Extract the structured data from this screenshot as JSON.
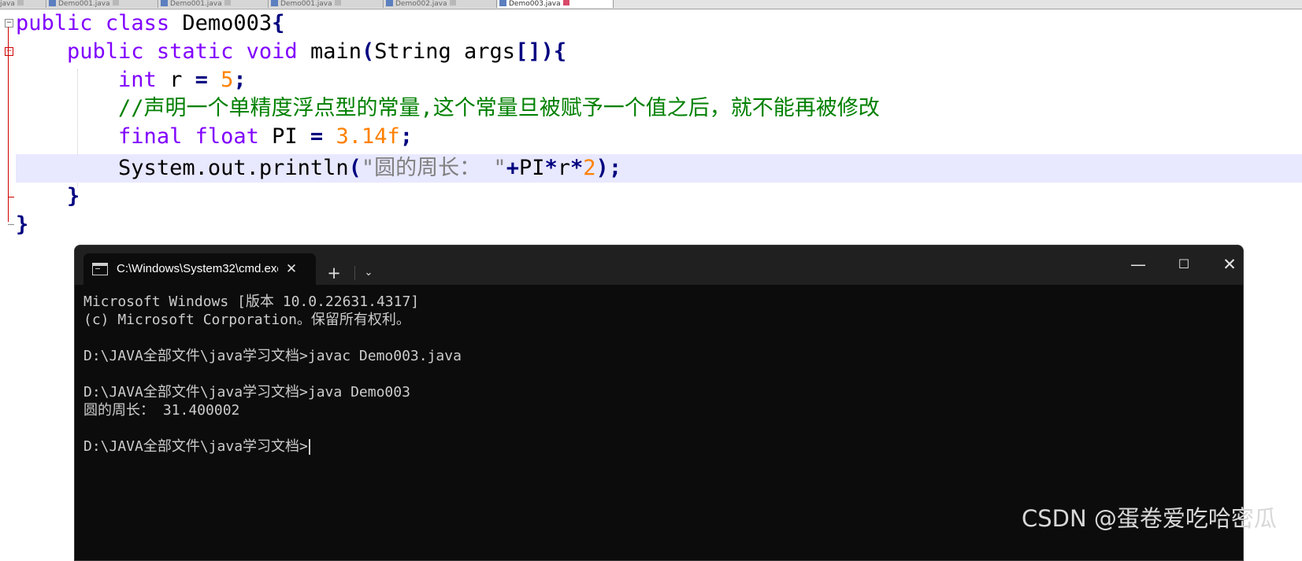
{
  "editor": {
    "tabs": [
      {
        "label": "java",
        "active": false
      },
      {
        "label": "Demo001.java",
        "active": false
      },
      {
        "label": "Demo001.java",
        "active": false
      },
      {
        "label": "Demo001.java",
        "active": false
      },
      {
        "label": "Demo002.java",
        "active": false
      },
      {
        "label": "Demo003.java",
        "active": true
      }
    ],
    "code": {
      "l1_kw1": "public",
      "l1_kw2": "class",
      "l1_name": "Demo003",
      "l1_brace": "{",
      "l2_kw1": "public",
      "l2_kw2": "static",
      "l2_kw3": "void",
      "l2_method": "main",
      "l2_paren_open": "(",
      "l2_param": "String args",
      "l2_brackets": "[])",
      "l2_brace": "{",
      "l3_kw": "int",
      "l3_var": "r",
      "l3_eq": "=",
      "l3_num": "5",
      "l3_semi": ";",
      "l4_comment": "//声明一个单精度浮点型的常量,这个常量旦被赋予一个值之后，就不能再被修改",
      "l5_kw1": "final",
      "l5_kw2": "float",
      "l5_var": "PI",
      "l5_eq": "=",
      "l5_num": "3.14f",
      "l5_semi": ";",
      "l6_call": "System.out.println",
      "l6_paren_open": "(",
      "l6_string": "\"圆的周长： \"",
      "l6_plus": "+",
      "l6_pi": "PI",
      "l6_mul1": "*",
      "l6_r": "r",
      "l6_mul2": "*",
      "l6_num": "2",
      "l6_paren_close": ")",
      "l6_semi": ";",
      "l7_brace": "}",
      "l8_brace": "}"
    }
  },
  "console": {
    "tab_title": "C:\\Windows\\System32\\cmd.exe",
    "close_tab": "✕",
    "new_tab": "+",
    "dropdown": "⌄",
    "minimize": "—",
    "maximize": "☐",
    "close": "✕",
    "lines": [
      "Microsoft Windows [版本 10.0.22631.4317]",
      "(c) Microsoft Corporation。保留所有权利。",
      "",
      "D:\\JAVA全部文件\\java学习文档>javac Demo003.java",
      "",
      "D:\\JAVA全部文件\\java学习文档>java Demo003",
      "圆的周长： 31.400002",
      "",
      "D:\\JAVA全部文件\\java学习文档>"
    ]
  },
  "watermark": "CSDN @蛋卷爱吃哈密瓜"
}
